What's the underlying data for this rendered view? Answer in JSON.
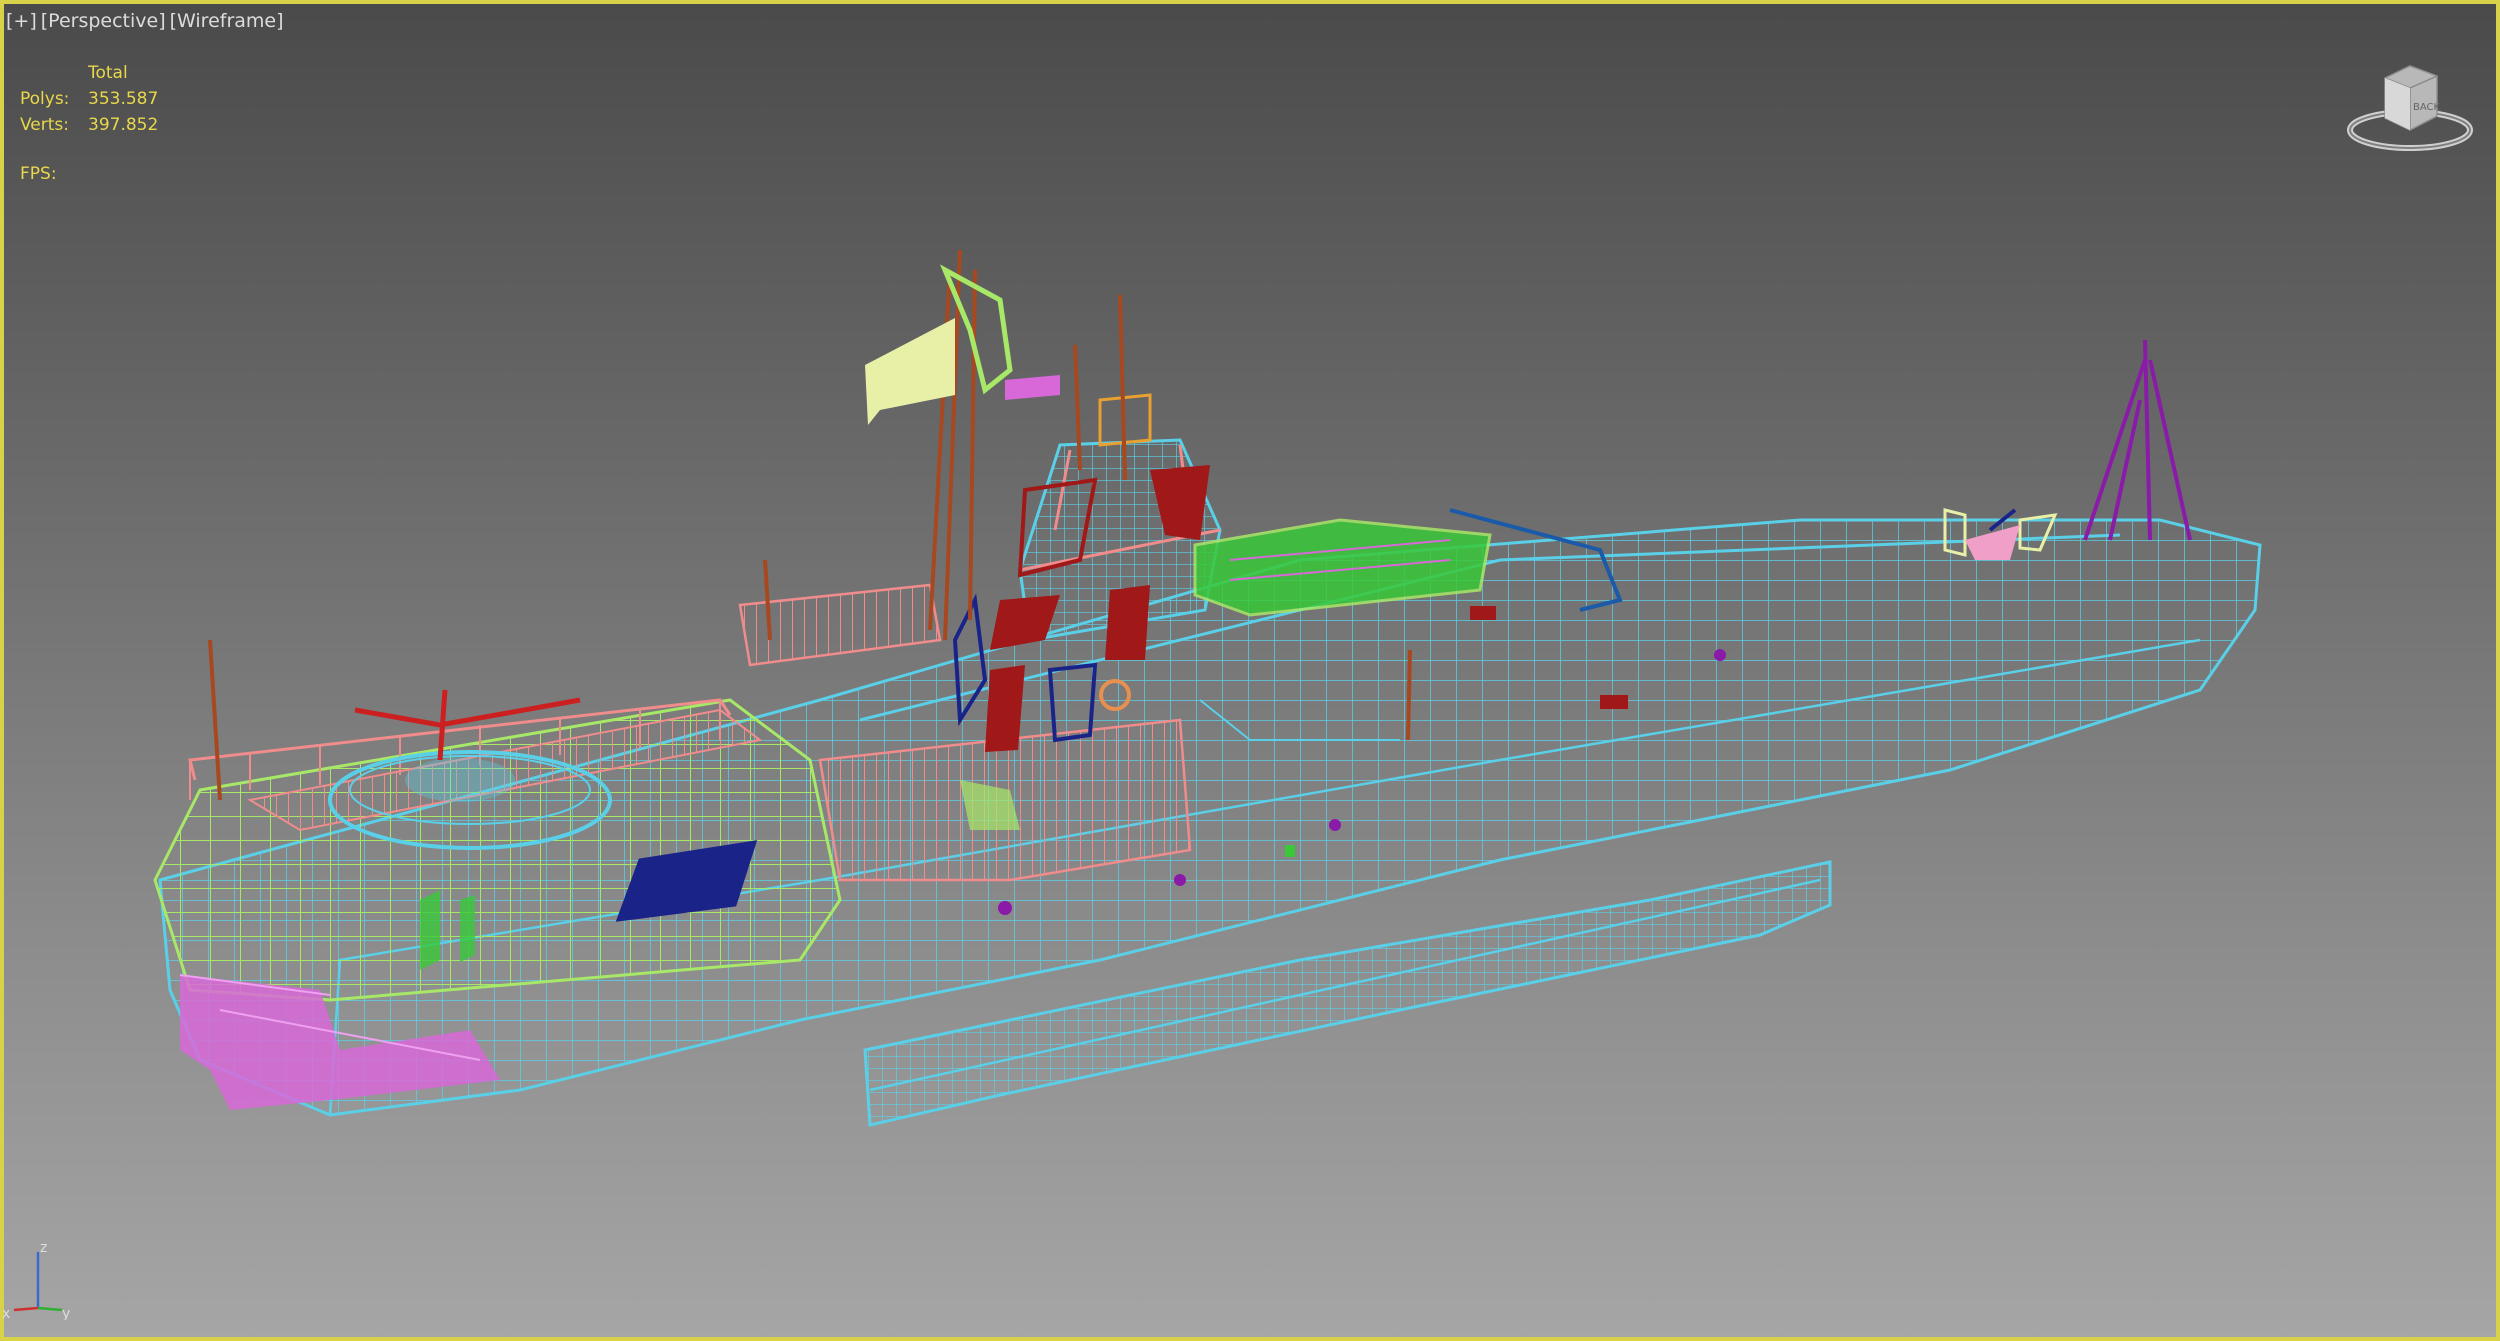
{
  "viewport": {
    "labels": [
      "[+]",
      "[Perspective]",
      "[Wireframe]"
    ],
    "border_color": "#d8d24a"
  },
  "stats": {
    "header": "Total",
    "polys_label": "Polys:",
    "polys_value": "353.587",
    "verts_label": "Verts:",
    "verts_value": "397.852",
    "fps_label": "FPS:",
    "text_color": "#e8d84a"
  },
  "viewcube": {
    "face_label": "BACK",
    "icon": "viewcube-icon"
  },
  "axis_gizmo": {
    "x": "x",
    "y": "y",
    "z": "z"
  },
  "scene_colors": {
    "hull": "#5ad0e8",
    "railing": "#f08c8c",
    "deck": "#a8e868",
    "accent_green": "#38c838",
    "magenta": "#d868d8",
    "dark_red": "#a01818",
    "navy": "#1a2488",
    "purple": "#8a1aa8",
    "mast": "#a84820",
    "flag": "#e8f0a8"
  }
}
